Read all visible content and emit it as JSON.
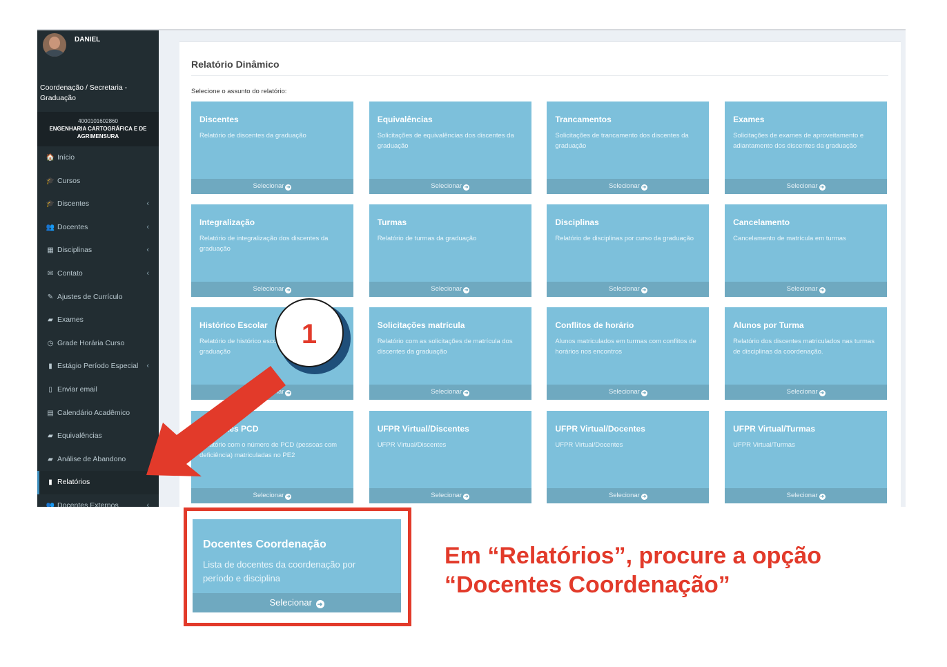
{
  "sidebar": {
    "user_name": "DANIEL",
    "role": "Coordenação / Secretaria - Graduação",
    "course_code": "4000101602860",
    "course_name": "ENGENHARIA CARTOGRÁFICA E DE AGRIMENSURA",
    "items": [
      {
        "label": "Início",
        "icon": "home-icon",
        "glyph": "🏠"
      },
      {
        "label": "Cursos",
        "icon": "graduation-cap-icon",
        "glyph": "🎓"
      },
      {
        "label": "Discentes",
        "icon": "graduation-cap-icon",
        "glyph": "🎓"
      },
      {
        "label": "Docentes",
        "icon": "users-icon",
        "glyph": "👥"
      },
      {
        "label": "Disciplinas",
        "icon": "grid-icon",
        "glyph": "▦"
      },
      {
        "label": "Contato",
        "icon": "envelope-icon",
        "glyph": "✉"
      },
      {
        "label": "Ajustes de Currículo",
        "icon": "edit-icon",
        "glyph": "✎"
      },
      {
        "label": "Exames",
        "icon": "book-icon",
        "glyph": "▰"
      },
      {
        "label": "Grade Horária Curso",
        "icon": "clock-icon",
        "glyph": "◷"
      },
      {
        "label": "Estágio Período Especial",
        "icon": "id-card-icon",
        "glyph": "▮"
      },
      {
        "label": "Enviar email",
        "icon": "file-icon",
        "glyph": "▯"
      },
      {
        "label": "Calendário Acadêmico",
        "icon": "calendar-icon",
        "glyph": "▤"
      },
      {
        "label": "Equivalências",
        "icon": "book-icon",
        "glyph": "▰"
      },
      {
        "label": "Análise de Abandono",
        "icon": "book-icon",
        "glyph": "▰"
      },
      {
        "label": "Relatórios",
        "icon": "file-icon",
        "glyph": "▮"
      },
      {
        "label": "Docentes Externos",
        "icon": "users-icon",
        "glyph": "👥"
      }
    ]
  },
  "main": {
    "title": "Relatório Dinâmico",
    "prompt": "Selecione o assunto do relatório:",
    "select_label": "Selecionar",
    "tiles": [
      {
        "title": "Discentes",
        "desc": "Relatório de discentes da graduação"
      },
      {
        "title": "Equivalências",
        "desc": "Solicitações de equivalências dos discentes da graduação"
      },
      {
        "title": "Trancamentos",
        "desc": "Solicitações de trancamento dos discentes da graduação"
      },
      {
        "title": "Exames",
        "desc": "Solicitações de exames de aproveitamento e adiantamento dos discentes da graduação"
      },
      {
        "title": "Integralização",
        "desc": "Relatório de integralização dos discentes da graduação"
      },
      {
        "title": "Turmas",
        "desc": "Relatório de turmas da graduação"
      },
      {
        "title": "Disciplinas",
        "desc": "Relatório de disciplinas por curso da graduação"
      },
      {
        "title": "Cancelamento",
        "desc": "Cancelamento de matrícula em turmas"
      },
      {
        "title": "Histórico Escolar",
        "desc": "Relatório de histórico escolar dos discentes da graduação"
      },
      {
        "title": "Solicitações matrícula",
        "desc": "Relatório com as solicitações de matrícula dos discentes da graduação"
      },
      {
        "title": "Conflitos de horário",
        "desc": "Alunos matriculados em turmas com conflitos de horários nos encontros"
      },
      {
        "title": "Alunos por Turma",
        "desc": "Relatório dos discentes matriculados nas turmas de disciplinas da coordenação."
      },
      {
        "title": "Discentes PCD",
        "desc": "Relatório com o número de PCD (pessoas com deficiência) matriculadas no PE2"
      },
      {
        "title": "UFPR Virtual/Discentes",
        "desc": "UFPR Virtual/Discentes"
      },
      {
        "title": "UFPR Virtual/Docentes",
        "desc": "UFPR Virtual/Docentes"
      },
      {
        "title": "UFPR Virtual/Turmas",
        "desc": "UFPR Virtual/Turmas"
      }
    ]
  },
  "annotation": {
    "badge_number": "1",
    "zoom_card": {
      "title": "Docentes Coordenação",
      "desc": "Lista de docentes da coordenação por período e disciplina",
      "select_label": "Selecionar"
    },
    "instruction": "Em “Relatórios”, procure a opção “Docentes Coordenação”",
    "accent_color": "#e23a2a"
  },
  "colors": {
    "sidebar_bg": "#222d32",
    "tile_bg": "#7dc0db",
    "tile_footer_bg": "#6fa9c0"
  }
}
